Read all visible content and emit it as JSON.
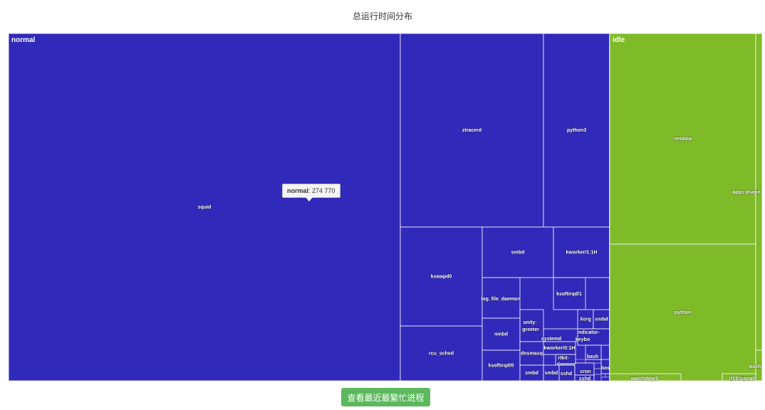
{
  "title": "总运行时间分布",
  "tooltip": {
    "name": "normal",
    "value": "274 770"
  },
  "button_label": "查看最近最繁忙进程",
  "colors": {
    "normal": "#3129b9",
    "idle": "#7fba28",
    "border": "#ffffff"
  },
  "chart_data": {
    "type": "treemap",
    "title": "总运行时间分布",
    "groups": [
      {
        "name": "normal",
        "value": 274770,
        "color": "#3129b9",
        "children": [
          {
            "name": "squid",
            "value": 142680
          },
          {
            "name": "ztracerd",
            "value": 39680
          },
          {
            "name": "python3",
            "value": 16630
          },
          {
            "name": "kswapd0",
            "value": 12530
          },
          {
            "name": "rcu_sched",
            "value": 8680
          },
          {
            "name": "smbd",
            "value": 6800
          },
          {
            "name": "kworker/1:1H",
            "value": 5600
          },
          {
            "name": "log_file_daemon",
            "value": 3140
          },
          {
            "name": "ksoftirqd/1",
            "value": 2420
          },
          {
            "name": "nmbd",
            "value": 2730
          },
          {
            "name": "ksoftirqd/0",
            "value": 2430
          },
          {
            "name": "unity-greeter",
            "value": 1100
          },
          {
            "name": "systemd",
            "value": 1280
          },
          {
            "name": "Xorg",
            "value": 460
          },
          {
            "name": "smbd",
            "value": 460
          },
          {
            "name": "indicator-keybo",
            "value": 580
          },
          {
            "name": "dnsmasq",
            "value": 610
          },
          {
            "name": "kworker/0:1H",
            "value": 580
          },
          {
            "name": "rtkit-daemon",
            "value": 620
          },
          {
            "name": "bash",
            "value": 320
          },
          {
            "name": "smbd",
            "value": 590
          },
          {
            "name": "smbd",
            "value": 560
          },
          {
            "name": "sshd",
            "value": 390
          },
          {
            "name": "cron",
            "value": 340
          },
          {
            "name": "bash",
            "value": 210
          },
          {
            "name": "sshd",
            "value": 220
          }
        ]
      },
      {
        "name": "idle",
        "value": 125300,
        "color": "#7fba28",
        "children": [
          {
            "name": "netdata",
            "value": 61200
          },
          {
            "name": "python",
            "value": 55500
          },
          {
            "name": "apps.plugin",
            "value": 6200
          },
          {
            "name": "bash",
            "value": 1500
          },
          {
            "name": "watchdog/0",
            "value": 430
          },
          {
            "name": "(f15/signal0",
            "value": 470
          }
        ]
      }
    ]
  }
}
